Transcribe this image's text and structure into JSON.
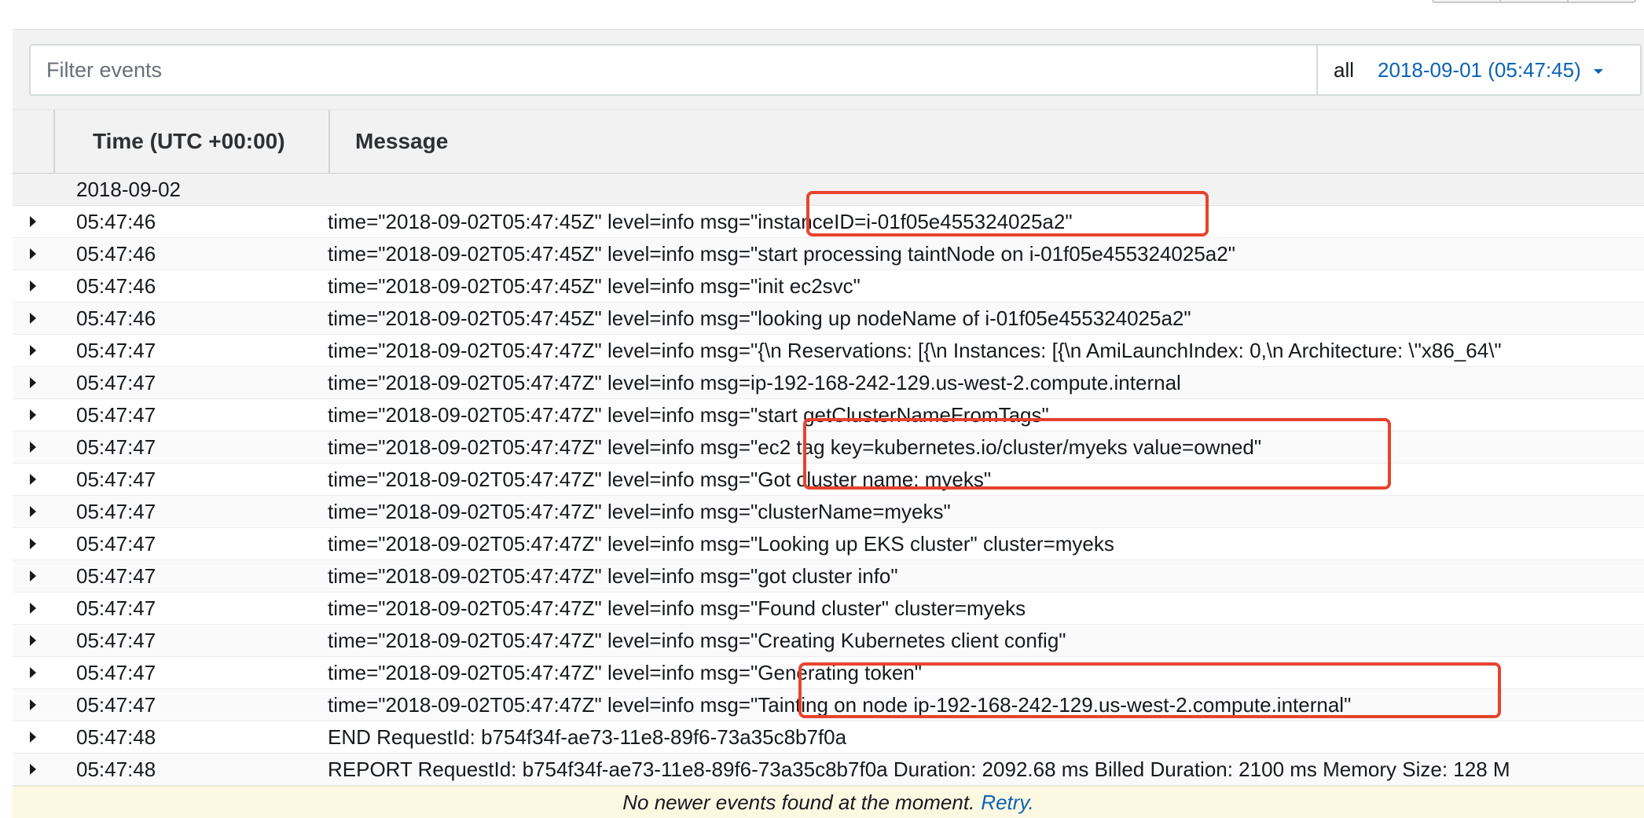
{
  "filter": {
    "placeholder": "Filter events"
  },
  "range": {
    "all_label": "all",
    "date_label": "2018-09-01 (05:47:45)"
  },
  "columns": {
    "time": "Time (UTC +00:00)",
    "message": "Message"
  },
  "date_group": "2018-09-02",
  "rows": [
    {
      "time": "05:47:46",
      "message": "time=\"2018-09-02T05:47:45Z\" level=info msg=\"instanceID=i-01f05e455324025a2\""
    },
    {
      "time": "05:47:46",
      "message": "time=\"2018-09-02T05:47:45Z\" level=info msg=\"start processing taintNode on i-01f05e455324025a2\""
    },
    {
      "time": "05:47:46",
      "message": "time=\"2018-09-02T05:47:45Z\" level=info msg=\"init ec2svc\""
    },
    {
      "time": "05:47:46",
      "message": "time=\"2018-09-02T05:47:45Z\" level=info msg=\"looking up nodeName of i-01f05e455324025a2\""
    },
    {
      "time": "05:47:47",
      "message": "time=\"2018-09-02T05:47:47Z\" level=info msg=\"{\\n Reservations: [{\\n Instances: [{\\n AmiLaunchIndex: 0,\\n Architecture: \\\"x86_64\\\""
    },
    {
      "time": "05:47:47",
      "message": "time=\"2018-09-02T05:47:47Z\" level=info msg=ip-192-168-242-129.us-west-2.compute.internal"
    },
    {
      "time": "05:47:47",
      "message": "time=\"2018-09-02T05:47:47Z\" level=info msg=\"start getClusterNameFromTags\""
    },
    {
      "time": "05:47:47",
      "message": "time=\"2018-09-02T05:47:47Z\" level=info msg=\"ec2 tag key=kubernetes.io/cluster/myeks value=owned\""
    },
    {
      "time": "05:47:47",
      "message": "time=\"2018-09-02T05:47:47Z\" level=info msg=\"Got cluster name: myeks\""
    },
    {
      "time": "05:47:47",
      "message": "time=\"2018-09-02T05:47:47Z\" level=info msg=\"clusterName=myeks\""
    },
    {
      "time": "05:47:47",
      "message": "time=\"2018-09-02T05:47:47Z\" level=info msg=\"Looking up EKS cluster\" cluster=myeks"
    },
    {
      "time": "05:47:47",
      "message": "time=\"2018-09-02T05:47:47Z\" level=info msg=\"got cluster info\""
    },
    {
      "time": "05:47:47",
      "message": "time=\"2018-09-02T05:47:47Z\" level=info msg=\"Found cluster\" cluster=myeks"
    },
    {
      "time": "05:47:47",
      "message": "time=\"2018-09-02T05:47:47Z\" level=info msg=\"Creating Kubernetes client config\""
    },
    {
      "time": "05:47:47",
      "message": "time=\"2018-09-02T05:47:47Z\" level=info msg=\"Generating token\""
    },
    {
      "time": "05:47:47",
      "message": "time=\"2018-09-02T05:47:47Z\" level=info msg=\"Tainting on node ip-192-168-242-129.us-west-2.compute.internal\""
    },
    {
      "time": "05:47:48",
      "message": "END RequestId: b754f34f-ae73-11e8-89f6-73a35c8b7f0a"
    },
    {
      "time": "05:47:48",
      "message": "REPORT RequestId: b754f34f-ae73-11e8-89f6-73a35c8b7f0a Duration: 2092.68 ms Billed Duration: 2100 ms Memory Size: 128 M"
    }
  ],
  "footer": {
    "text": "No newer events found at the moment.",
    "retry": "Retry."
  },
  "colors": {
    "highlight": "#e8432e",
    "link": "#0a63b6",
    "footer_bg": "#fdf8e2"
  }
}
